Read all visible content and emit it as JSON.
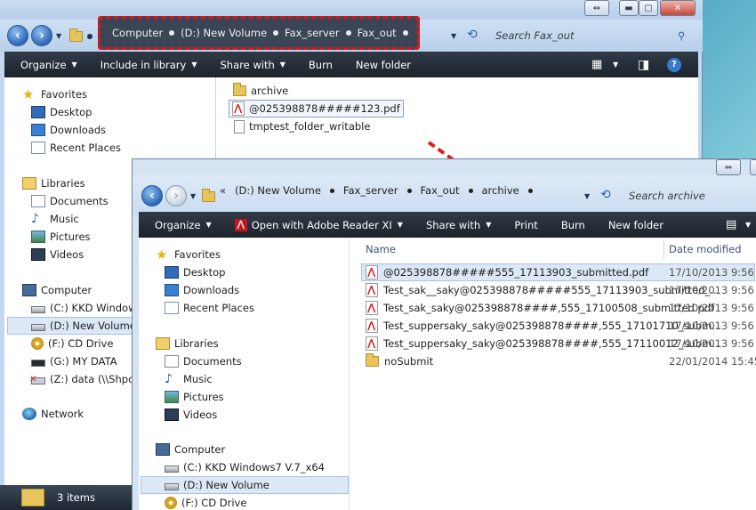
{
  "back_window": {
    "address_crumbs": [
      "Computer",
      "(D:) New Volume",
      "Fax_server",
      "Fax_out"
    ],
    "search_placeholder": "Search Fax_out",
    "toolbar": {
      "organize": "Organize",
      "include_in_library": "Include in library",
      "share_with": "Share with",
      "burn": "Burn",
      "new_folder": "New folder"
    },
    "nav": {
      "favorites": "Favorites",
      "desktop": "Desktop",
      "downloads": "Downloads",
      "recent_places": "Recent Places",
      "libraries": "Libraries",
      "documents": "Documents",
      "music": "Music",
      "pictures": "Pictures",
      "videos": "Videos",
      "computer": "Computer",
      "drive_c": "(C:) KKD Windows7",
      "drive_d": "(D:) New Volume",
      "drive_f": "(F:) CD Drive",
      "drive_g": "(G:) MY DATA",
      "drive_z": "(Z:) data (\\\\Shpc_s",
      "network": "Network"
    },
    "files": [
      "archive",
      "@025398878#####123.pdf",
      "tmptest_folder_writable"
    ],
    "status": "3 items"
  },
  "front_window": {
    "address_crumbs": [
      "(D:) New Volume",
      "Fax_server",
      "Fax_out",
      "archive"
    ],
    "address_prefix": "«",
    "search_placeholder": "Search archive",
    "toolbar": {
      "organize": "Organize",
      "open_with": "Open with Adobe Reader XI",
      "share_with": "Share with",
      "print": "Print",
      "burn": "Burn",
      "new_folder": "New folder"
    },
    "nav": {
      "favorites": "Favorites",
      "desktop": "Desktop",
      "downloads": "Downloads",
      "recent_places": "Recent Places",
      "libraries": "Libraries",
      "documents": "Documents",
      "music": "Music",
      "pictures": "Pictures",
      "videos": "Videos",
      "computer": "Computer",
      "drive_c": "(C:) KKD Windows7 V.7_x64",
      "drive_d": "(D:) New Volume",
      "drive_f": "(F:) CD Drive"
    },
    "columns": {
      "name": "Name",
      "date_modified": "Date modified"
    },
    "files": [
      {
        "name": "@025398878#####555_17113903_submitted.pdf",
        "date": "17/10/2013 9:56",
        "type": "pdf"
      },
      {
        "name": "Test_sak__saky@025398878#####555_17113903_submitted_...",
        "date": "17/10/2013 9:56",
        "type": "pdf"
      },
      {
        "name": "Test_sak_saky@025398878####,555_17100508_submitted.pdf",
        "date": "17/10/2013 9:56",
        "type": "pdf"
      },
      {
        "name": "Test_suppersaky_saky@025398878####,555_17101710_subm...",
        "date": "17/10/2013 9:56",
        "type": "pdf"
      },
      {
        "name": "Test_suppersaky_saky@025398878####,555_17110012_subm...",
        "date": "17/10/2013 9:56",
        "type": "pdf"
      },
      {
        "name": "noSubmit",
        "date": "22/01/2014 15:45",
        "type": "folder"
      }
    ]
  },
  "colors": {
    "highlight_dash": "#e2141b",
    "toolbar_bg": "#1c232c",
    "selection": "#dce8f6",
    "arrow": "#d8221b"
  },
  "icons": [
    "back-arrow-icon",
    "forward-arrow-icon",
    "refresh-icon",
    "search-icon",
    "help-icon",
    "view-options-icon",
    "preview-pane-icon",
    "pdf-icon",
    "folder-icon"
  ]
}
